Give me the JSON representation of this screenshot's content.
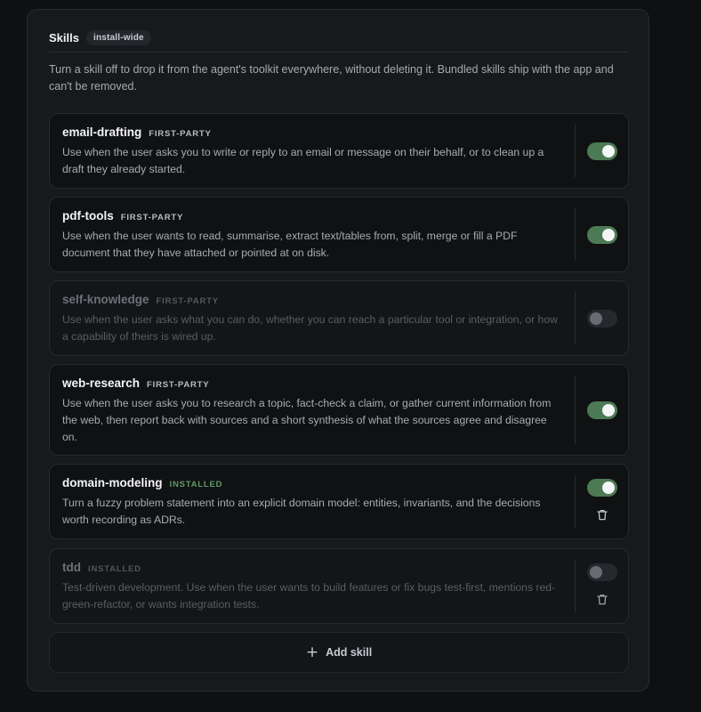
{
  "section": {
    "title": "Skills",
    "badge": "install-wide",
    "description": "Turn a skill off to drop it from the agent's toolkit everywhere, without deleting it. Bundled skills ship with the app and can't be removed."
  },
  "skills": [
    {
      "name": "email-drafting",
      "tag": "FIRST-PARTY",
      "description": "Use when the user asks you to write or reply to an email or message on their behalf, or to clean up a draft they already started.",
      "enabled": true,
      "deletable": false
    },
    {
      "name": "pdf-tools",
      "tag": "FIRST-PARTY",
      "description": "Use when the user wants to read, summarise, extract text/tables from, split, merge or fill a PDF document that they have attached or pointed at on disk.",
      "enabled": true,
      "deletable": false
    },
    {
      "name": "self-knowledge",
      "tag": "FIRST-PARTY",
      "description": "Use when the user asks what you can do, whether you can reach a particular tool or integration, or how a capability of theirs is wired up.",
      "enabled": false,
      "deletable": false
    },
    {
      "name": "web-research",
      "tag": "FIRST-PARTY",
      "description": "Use when the user asks you to research a topic, fact-check a claim, or gather current information from the web, then report back with sources and a short synthesis of what the sources agree and disagree on.",
      "enabled": true,
      "deletable": false
    },
    {
      "name": "domain-modeling",
      "tag": "INSTALLED",
      "description": "Turn a fuzzy problem statement into an explicit domain model: entities, invariants, and the decisions worth recording as ADRs.",
      "enabled": true,
      "deletable": true
    },
    {
      "name": "tdd",
      "tag": "INSTALLED",
      "description": "Test-driven development. Use when the user wants to build features or fix bugs test-first, mentions red-green-refactor, or wants integration tests.",
      "enabled": false,
      "deletable": true
    }
  ],
  "add_button": {
    "icon": "plus-icon",
    "label": "Add skill"
  },
  "colors": {
    "toggle_on": "#4c7a55",
    "installed_tag": "#5f9a6a",
    "panel_bg": "#18191c",
    "card_bg": "#101113"
  }
}
